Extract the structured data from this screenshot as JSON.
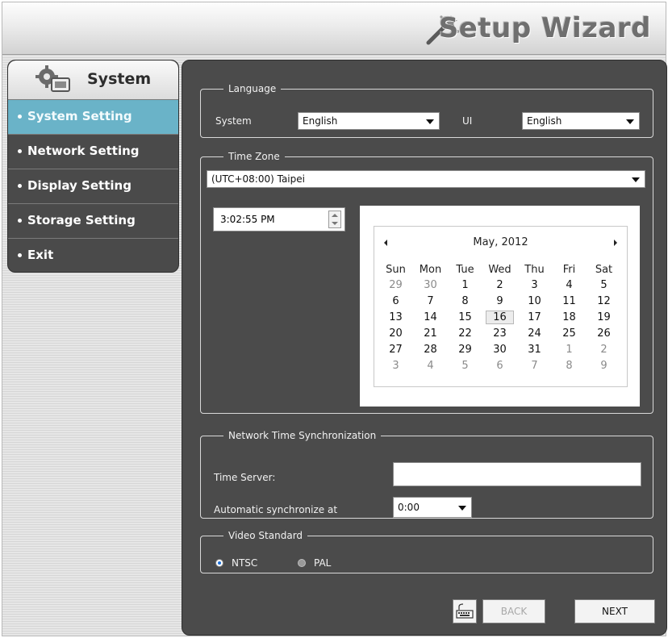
{
  "window": {
    "title": "Setup Wizard"
  },
  "sidebar": {
    "header": "System",
    "items": [
      {
        "label": "System Setting",
        "active": true
      },
      {
        "label": "Network Setting",
        "active": false
      },
      {
        "label": "Display Setting",
        "active": false
      },
      {
        "label": "Storage Setting",
        "active": false
      },
      {
        "label": "Exit",
        "active": false
      }
    ]
  },
  "language": {
    "legend": "Language",
    "system_label": "System",
    "system_value": "English",
    "ui_label": "UI",
    "ui_value": "English"
  },
  "timezone": {
    "legend": "Time Zone",
    "value": "(UTC+08:00) Taipei",
    "time": "3:02:55 PM"
  },
  "calendar": {
    "month_label": "May, 2012",
    "weekdays": [
      "Sun",
      "Mon",
      "Tue",
      "Wed",
      "Thu",
      "Fri",
      "Sat"
    ],
    "weeks": [
      [
        "29",
        "30",
        "1",
        "2",
        "3",
        "4",
        "5"
      ],
      [
        "6",
        "7",
        "8",
        "9",
        "10",
        "11",
        "12"
      ],
      [
        "13",
        "14",
        "15",
        "16",
        "17",
        "18",
        "19"
      ],
      [
        "20",
        "21",
        "22",
        "23",
        "24",
        "25",
        "26"
      ],
      [
        "27",
        "28",
        "29",
        "30",
        "31",
        "1",
        "2"
      ],
      [
        "3",
        "4",
        "5",
        "6",
        "7",
        "8",
        "9"
      ]
    ],
    "selected_day": "16"
  },
  "ntp": {
    "legend": "Network Time Synchronization",
    "server_label": "Time Server:",
    "server_value": "",
    "auto_label": "Automatic synchronize at",
    "auto_value": "0:00"
  },
  "video": {
    "legend": "Video Standard",
    "ntsc_label": "NTSC",
    "pal_label": "PAL",
    "selected": "NTSC"
  },
  "buttons": {
    "back_label": "BACK",
    "next_label": "NEXT",
    "keyboard_icon": "keyboard-icon"
  },
  "colors": {
    "accent": "#6ab3c8",
    "panel": "#4b4b4b",
    "radio_selected": "#1d6fd6"
  }
}
